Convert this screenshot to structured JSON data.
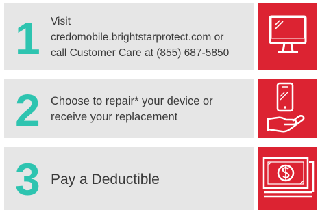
{
  "colors": {
    "panel_bg": "#e6e6e6",
    "number": "#2ec4b0",
    "icon_bg": "#dc2332",
    "text": "#3a3a3a"
  },
  "steps": [
    {
      "number": "1",
      "lines": [
        "Visit",
        "credomobile.brightstarprotect.com or",
        "call Customer Care at (855) 687-5850"
      ],
      "icon": "monitor-icon"
    },
    {
      "number": "2",
      "lines": [
        "Choose to repair* your device or",
        "receive your replacement"
      ],
      "icon": "phone-in-hand-icon"
    },
    {
      "number": "3",
      "lines": [
        "Pay a Deductible"
      ],
      "icon": "cash-stack-icon"
    }
  ]
}
